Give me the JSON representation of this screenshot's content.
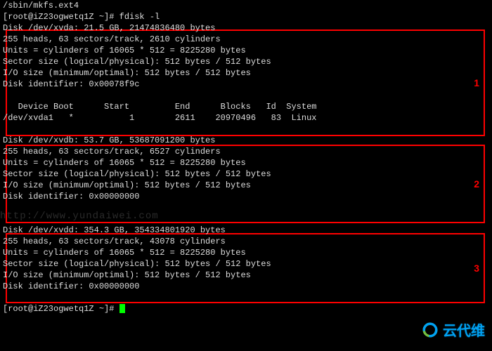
{
  "prelines": [
    "/sbin/mkfs.ext4",
    "[root@iZ23ogwetq1Z ~]# fdisk -l",
    ""
  ],
  "disk1": {
    "header": "Disk /dev/xvda: 21.5 GB, 21474836480 bytes",
    "geom": "255 heads, 63 sectors/track, 2610 cylinders",
    "units": "Units = cylinders of 16065 * 512 = 8225280 bytes",
    "sector": "Sector size (logical/physical): 512 bytes / 512 bytes",
    "io": "I/O size (minimum/optimal): 512 bytes / 512 bytes",
    "ident": "Disk identifier: 0x00078f9c",
    "cols": "   Device Boot      Start         End      Blocks   Id  System",
    "row": "/dev/xvda1   *           1        2611    20970496   83  Linux",
    "label": "1"
  },
  "disk2": {
    "header": "Disk /dev/xvdb: 53.7 GB, 53687091200 bytes",
    "geom": "255 heads, 63 sectors/track, 6527 cylinders",
    "units": "Units = cylinders of 16065 * 512 = 8225280 bytes",
    "sector": "Sector size (logical/physical): 512 bytes / 512 bytes",
    "io": "I/O size (minimum/optimal): 512 bytes / 512 bytes",
    "ident": "Disk identifier: 0x00000000",
    "label": "2"
  },
  "disk3": {
    "header": "Disk /dev/xvdd: 354.3 GB, 354334801920 bytes",
    "geom": "255 heads, 63 sectors/track, 43078 cylinders",
    "units": "Units = cylinders of 16065 * 512 = 8225280 bytes",
    "sector": "Sector size (logical/physical): 512 bytes / 512 bytes",
    "io": "I/O size (minimum/optimal): 512 bytes / 512 bytes",
    "ident": "Disk identifier: 0x00000000",
    "label": "3"
  },
  "prompt": "[root@iZ23ogwetq1Z ~]# ",
  "watermark": "云代维",
  "ghost_bg": "http://www.yundaiwei.com"
}
